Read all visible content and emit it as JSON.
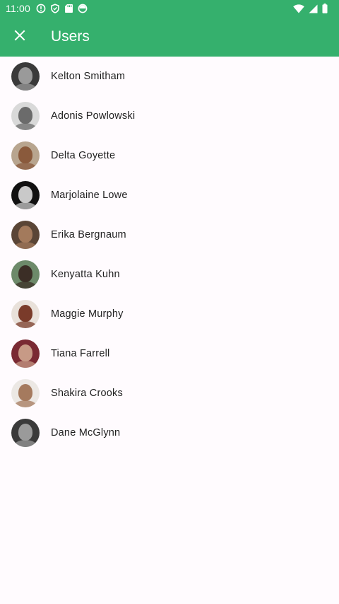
{
  "status_bar": {
    "time": "11:00",
    "left_icons": [
      "alert-circle-icon",
      "shield-icon",
      "sd-card-icon",
      "data-saver-icon"
    ],
    "right_icons": [
      "wifi-icon",
      "cell-signal-icon",
      "battery-icon"
    ]
  },
  "app_bar": {
    "title": "Users",
    "close_icon": "close-icon",
    "color": "#35b06d"
  },
  "users": [
    {
      "name": "Kelton Smitham",
      "avatar_bg": "#3a3a3a",
      "avatar_face": "#9a9a9a"
    },
    {
      "name": "Adonis Powlowski",
      "avatar_bg": "#d9d9d9",
      "avatar_face": "#6b6b6b"
    },
    {
      "name": "Delta Goyette",
      "avatar_bg": "#b8a58f",
      "avatar_face": "#8a5a3c"
    },
    {
      "name": "Marjolaine Lowe",
      "avatar_bg": "#111111",
      "avatar_face": "#c9c9c9"
    },
    {
      "name": "Erika Bergnaum",
      "avatar_bg": "#5a4536",
      "avatar_face": "#a37a5c"
    },
    {
      "name": "Kenyatta Kuhn",
      "avatar_bg": "#6d8a6a",
      "avatar_face": "#3b2e26"
    },
    {
      "name": "Maggie Murphy",
      "avatar_bg": "#e9e1da",
      "avatar_face": "#7a3b2a"
    },
    {
      "name": "Tiana Farrell",
      "avatar_bg": "#7a2a33",
      "avatar_face": "#c79a86"
    },
    {
      "name": "Shakira Crooks",
      "avatar_bg": "#ece8e4",
      "avatar_face": "#a57a5e"
    },
    {
      "name": "Dane McGlynn",
      "avatar_bg": "#3a3a3a",
      "avatar_face": "#9a9a9a"
    }
  ]
}
